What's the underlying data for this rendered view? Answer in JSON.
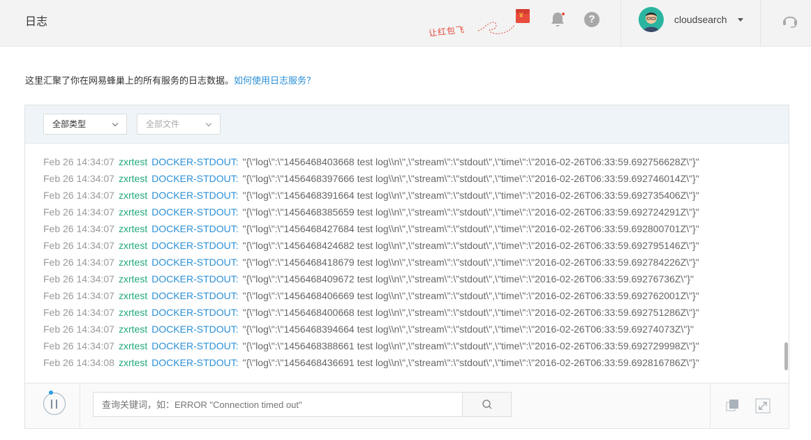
{
  "header": {
    "title": "日志",
    "red_packet_label": "让红包飞",
    "username": "cloudsearch"
  },
  "description": {
    "text": "这里汇聚了你在网易蜂巢上的所有服务的日志数据。",
    "link": "如何使用日志服务？"
  },
  "filters": {
    "type_select": "全部类型",
    "file_select": "全部文件"
  },
  "logs": [
    {
      "ts": "Feb 26 14:34:07",
      "app": "zxrtest",
      "src": "DOCKER-STDOUT:",
      "msg": "\"{\\\"log\\\":\\\"1456468403668 test log\\\\n\\\",\\\"stream\\\":\\\"stdout\\\",\\\"time\\\":\\\"2016-02-26T06:33:59.692756628Z\\\"}\""
    },
    {
      "ts": "Feb 26 14:34:07",
      "app": "zxrtest",
      "src": "DOCKER-STDOUT:",
      "msg": "\"{\\\"log\\\":\\\"1456468397666 test log\\\\n\\\",\\\"stream\\\":\\\"stdout\\\",\\\"time\\\":\\\"2016-02-26T06:33:59.692746014Z\\\"}\""
    },
    {
      "ts": "Feb 26 14:34:07",
      "app": "zxrtest",
      "src": "DOCKER-STDOUT:",
      "msg": "\"{\\\"log\\\":\\\"1456468391664 test log\\\\n\\\",\\\"stream\\\":\\\"stdout\\\",\\\"time\\\":\\\"2016-02-26T06:33:59.692735406Z\\\"}\""
    },
    {
      "ts": "Feb 26 14:34:07",
      "app": "zxrtest",
      "src": "DOCKER-STDOUT:",
      "msg": "\"{\\\"log\\\":\\\"1456468385659 test log\\\\n\\\",\\\"stream\\\":\\\"stdout\\\",\\\"time\\\":\\\"2016-02-26T06:33:59.692724291Z\\\"}\""
    },
    {
      "ts": "Feb 26 14:34:07",
      "app": "zxrtest",
      "src": "DOCKER-STDOUT:",
      "msg": "\"{\\\"log\\\":\\\"1456468427684 test log\\\\n\\\",\\\"stream\\\":\\\"stdout\\\",\\\"time\\\":\\\"2016-02-26T06:33:59.692800701Z\\\"}\""
    },
    {
      "ts": "Feb 26 14:34:07",
      "app": "zxrtest",
      "src": "DOCKER-STDOUT:",
      "msg": "\"{\\\"log\\\":\\\"1456468424682 test log\\\\n\\\",\\\"stream\\\":\\\"stdout\\\",\\\"time\\\":\\\"2016-02-26T06:33:59.692795146Z\\\"}\""
    },
    {
      "ts": "Feb 26 14:34:07",
      "app": "zxrtest",
      "src": "DOCKER-STDOUT:",
      "msg": "\"{\\\"log\\\":\\\"1456468418679 test log\\\\n\\\",\\\"stream\\\":\\\"stdout\\\",\\\"time\\\":\\\"2016-02-26T06:33:59.692784226Z\\\"}\""
    },
    {
      "ts": "Feb 26 14:34:07",
      "app": "zxrtest",
      "src": "DOCKER-STDOUT:",
      "msg": "\"{\\\"log\\\":\\\"1456468409672 test log\\\\n\\\",\\\"stream\\\":\\\"stdout\\\",\\\"time\\\":\\\"2016-02-26T06:33:59.69276736Z\\\"}\""
    },
    {
      "ts": "Feb 26 14:34:07",
      "app": "zxrtest",
      "src": "DOCKER-STDOUT:",
      "msg": "\"{\\\"log\\\":\\\"1456468406669 test log\\\\n\\\",\\\"stream\\\":\\\"stdout\\\",\\\"time\\\":\\\"2016-02-26T06:33:59.692762001Z\\\"}\""
    },
    {
      "ts": "Feb 26 14:34:07",
      "app": "zxrtest",
      "src": "DOCKER-STDOUT:",
      "msg": "\"{\\\"log\\\":\\\"1456468400668 test log\\\\n\\\",\\\"stream\\\":\\\"stdout\\\",\\\"time\\\":\\\"2016-02-26T06:33:59.692751286Z\\\"}\""
    },
    {
      "ts": "Feb 26 14:34:07",
      "app": "zxrtest",
      "src": "DOCKER-STDOUT:",
      "msg": "\"{\\\"log\\\":\\\"1456468394664 test log\\\\n\\\",\\\"stream\\\":\\\"stdout\\\",\\\"time\\\":\\\"2016-02-26T06:33:59.69274073Z\\\"}\""
    },
    {
      "ts": "Feb 26 14:34:07",
      "app": "zxrtest",
      "src": "DOCKER-STDOUT:",
      "msg": "\"{\\\"log\\\":\\\"1456468388661 test log\\\\n\\\",\\\"stream\\\":\\\"stdout\\\",\\\"time\\\":\\\"2016-02-26T06:33:59.692729998Z\\\"}\""
    },
    {
      "ts": "Feb 26 14:34:08",
      "app": "zxrtest",
      "src": "DOCKER-STDOUT:",
      "msg": "\"{\\\"log\\\":\\\"1456468436691 test log\\\\n\\\",\\\"stream\\\":\\\"stdout\\\",\\\"time\\\":\\\"2016-02-26T06:33:59.692816786Z\\\"}\""
    }
  ],
  "search": {
    "placeholder": "查询关键词，如：ERROR \"Connection timed out\""
  },
  "icons": {
    "red_packet": "red-packet-icon",
    "bell": "bell-icon",
    "help": "help-icon",
    "headset": "headset-icon",
    "pause": "pause-icon",
    "search": "search-icon",
    "copy": "copy-icon",
    "expand": "expand-icon"
  },
  "colors": {
    "app_name": "#1fa87c",
    "source": "#2a8fd6",
    "timestamp": "#9a9a9a",
    "link": "#2a8fd6",
    "red_packet": "#e84b3c"
  }
}
